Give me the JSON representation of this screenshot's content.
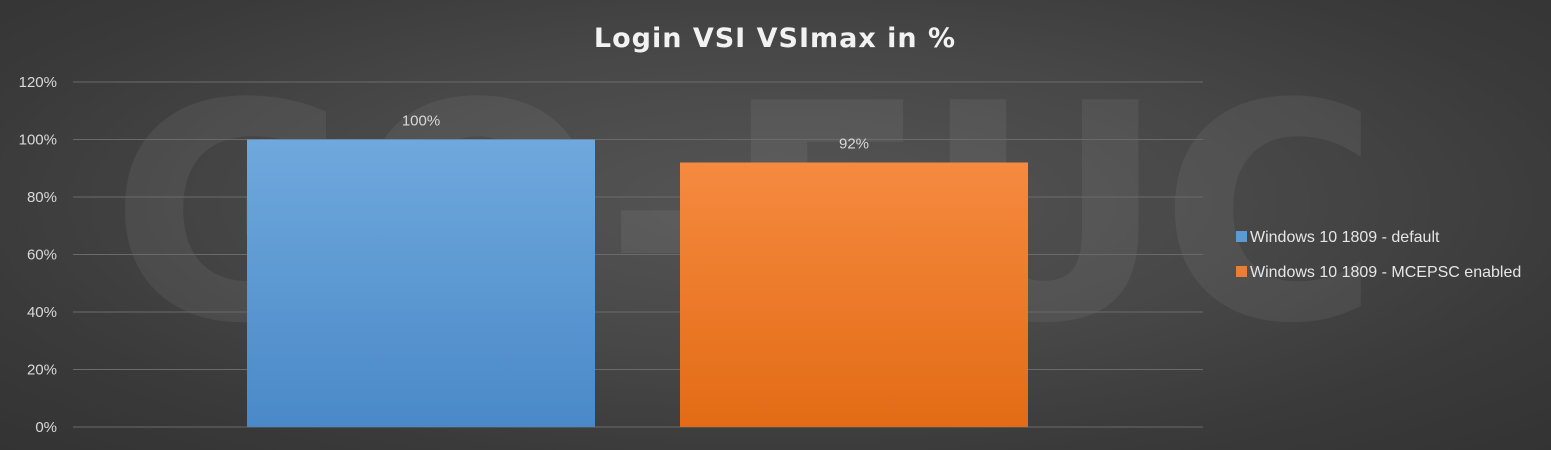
{
  "watermark": "GO-EUC",
  "chart_data": {
    "type": "bar",
    "title": "Login VSI VSImax in %",
    "categories": [
      ""
    ],
    "series": [
      {
        "name": "Windows 10 1809 - default",
        "values": [
          100
        ],
        "label": "100%",
        "color": "#5b9bd5"
      },
      {
        "name": "Windows 10 1809 - MCEPSC enabled",
        "values": [
          92
        ],
        "label": "92%",
        "color": "#ed7d31"
      }
    ],
    "ylim": [
      0,
      120
    ],
    "yticks": [
      "0%",
      "20%",
      "40%",
      "60%",
      "80%",
      "100%",
      "120%"
    ],
    "ytick_values": [
      0,
      20,
      40,
      60,
      80,
      100,
      120
    ],
    "grid": true,
    "legend": "right",
    "xlabel": "",
    "ylabel": ""
  }
}
